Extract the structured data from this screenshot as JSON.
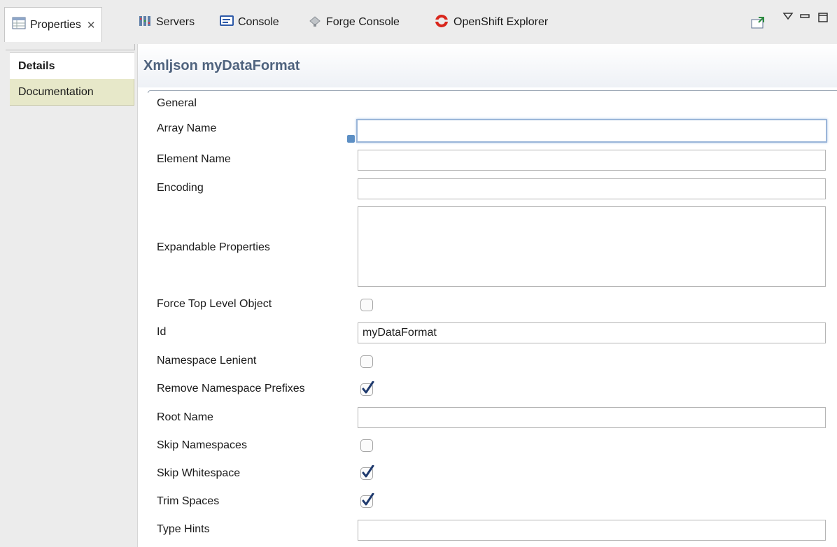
{
  "tabs": [
    {
      "label": "Properties",
      "icon": "properties-table-icon",
      "active": true
    },
    {
      "label": "Servers",
      "icon": "servers-icon"
    },
    {
      "label": "Console",
      "icon": "console-icon"
    },
    {
      "label": "Forge Console",
      "icon": "forge-icon"
    },
    {
      "label": "OpenShift Explorer",
      "icon": "openshift-icon"
    }
  ],
  "nav": {
    "details": "Details",
    "documentation": "Documentation"
  },
  "heading": {
    "title": "Xmljson myDataFormat"
  },
  "section": "General",
  "fields": {
    "array_name": {
      "label": "Array Name",
      "value": ""
    },
    "element_name": {
      "label": "Element Name",
      "value": ""
    },
    "encoding": {
      "label": "Encoding",
      "value": ""
    },
    "expandable_properties": {
      "label": "Expandable Properties",
      "value": ""
    },
    "force_top_level_object": {
      "label": "Force Top Level Object",
      "checked": false
    },
    "id": {
      "label": "Id",
      "value": "myDataFormat"
    },
    "namespace_lenient": {
      "label": "Namespace Lenient",
      "checked": false
    },
    "remove_namespace_prefixes": {
      "label": "Remove Namespace Prefixes",
      "checked": true
    },
    "root_name": {
      "label": "Root Name",
      "value": ""
    },
    "skip_namespaces": {
      "label": "Skip Namespaces",
      "checked": false
    },
    "skip_whitespace": {
      "label": "Skip Whitespace",
      "checked": true
    },
    "trim_spaces": {
      "label": "Trim Spaces",
      "checked": true
    },
    "type_hints": {
      "label": "Type Hints",
      "value": ""
    }
  },
  "colors": {
    "heading_text": "#4f637e",
    "nav_doc_bg": "#e7e8c9",
    "checkbox_check": "#1f3a6e",
    "openshift_red": "#d9261c"
  }
}
